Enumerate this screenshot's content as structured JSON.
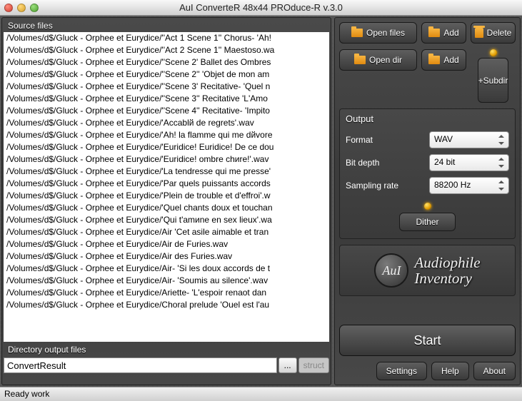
{
  "window": {
    "title": "AuI ConverteR 48x44 PROduce-R v.3.0"
  },
  "source": {
    "label": "Source files",
    "files": [
      "/Volumes/d$/Gluck - Orphee et Eurydice/''Act 1 Scene 1'' Chorus- 'Ah!",
      "/Volumes/d$/Gluck - Orphee et Eurydice/''Act 2 Scene 1'' Maestoso.wa",
      "/Volumes/d$/Gluck - Orphee et Eurydice/''Scene 2' Ballet des Ombres ",
      "/Volumes/d$/Gluck - Orphee et Eurydice/''Scene 2'' 'Objet de mon am",
      "/Volumes/d$/Gluck - Orphee et Eurydice/''Scene 3' Recitative- 'Quel n",
      "/Volumes/d$/Gluck - Orphee et Eurydice/''Scene 3'' Recitative 'L'Amo",
      "/Volumes/d$/Gluck - Orphee et Eurydice/''Scene 4'' Recitative- 'Impito",
      "/Volumes/d$/Gluck - Orphee et Eurydice/'Accablй de regrets'.wav",
      "/Volumes/d$/Gluck - Orphee et Eurydice/'Ah! la flamme qui me dйvore",
      "/Volumes/d$/Gluck - Orphee et Eurydice/'Euridice! Euridice! De ce dou",
      "/Volumes/d$/Gluck - Orphee et Eurydice/'Euridice! ombre chиre!'.wav",
      "/Volumes/d$/Gluck - Orphee et Eurydice/'La tendresse qui me presse'",
      "/Volumes/d$/Gluck - Orphee et Eurydice/'Par quels puissants accords",
      "/Volumes/d$/Gluck - Orphee et Eurydice/'Plein de trouble et d'effroi'.w",
      "/Volumes/d$/Gluck - Orphee et Eurydice/'Quel chants doux et touchan",
      "/Volumes/d$/Gluck - Orphee et Eurydice/'Qui t'amиne en sex lieux'.wa",
      "/Volumes/d$/Gluck - Orphee et Eurydice/Air 'Cet asile aimable et tran",
      "/Volumes/d$/Gluck - Orphee et Eurydice/Air de Furies.wav",
      "/Volumes/d$/Gluck - Orphee et Eurydice/Air des Furies.wav",
      "/Volumes/d$/Gluck - Orphee et Eurydice/Air- 'Si les doux accords de t",
      "/Volumes/d$/Gluck - Orphee et Eurydice/Air- 'Soumis au silence'.wav",
      "/Volumes/d$/Gluck - Orphee et Eurydice/Ariette- 'L'espoir renaоt dan",
      "/Volumes/d$/Gluck - Orphee et Eurydice/Choral prelude 'Ouel est l'au"
    ]
  },
  "output_dir": {
    "label": "Directory output files",
    "value": "ConvertResult",
    "browse": "...",
    "struct": "struct"
  },
  "buttons": {
    "open_files": "Open files",
    "add_files": "Add",
    "delete": "Delete",
    "open_dir": "Open dir",
    "add_dir": "Add",
    "subdir": "+Subdir",
    "dither": "Dither",
    "start": "Start",
    "settings": "Settings",
    "help": "Help",
    "about": "About"
  },
  "output": {
    "label": "Output",
    "format_label": "Format",
    "format_value": "WAV",
    "bitdepth_label": "Bit depth",
    "bitdepth_value": "24 bit",
    "srate_label": "Sampling rate",
    "srate_value": "88200 Hz"
  },
  "brand": {
    "emblem": "AuI",
    "line1": "Audiophile",
    "line2": "Inventory"
  },
  "status": "Ready work"
}
